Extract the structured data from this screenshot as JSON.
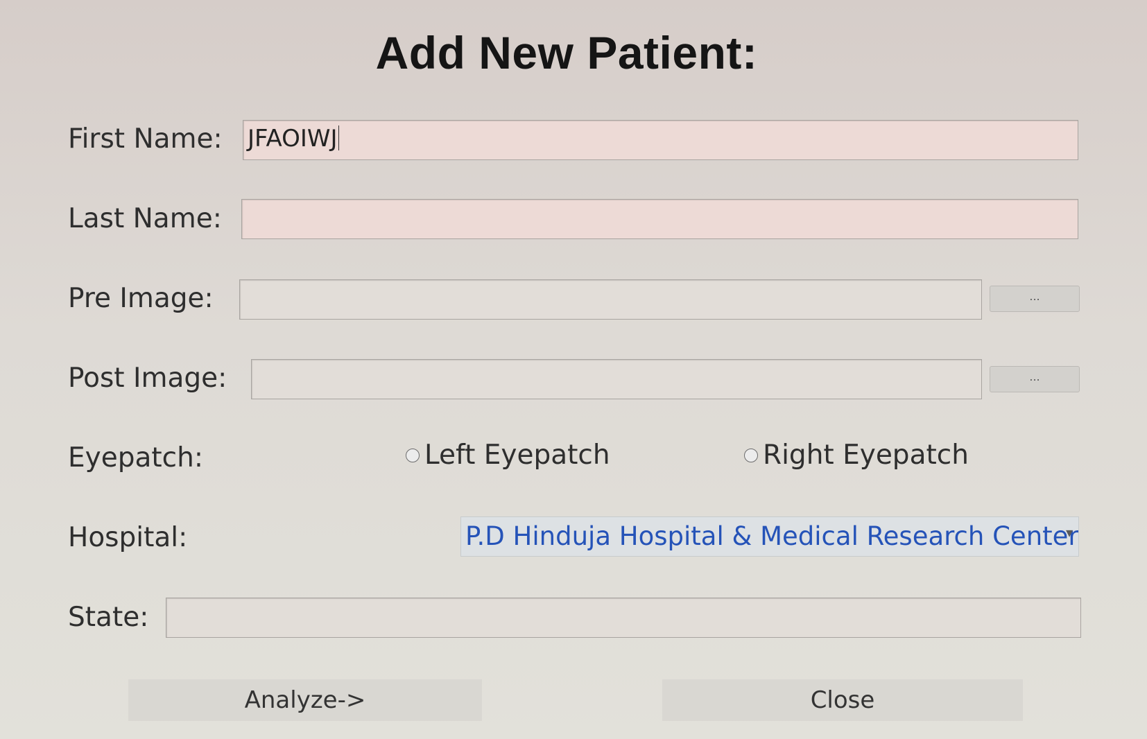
{
  "dialog": {
    "title": "Add New Patient:"
  },
  "form": {
    "first_name": {
      "label": "First Name:",
      "value": "JFAOIWJ"
    },
    "last_name": {
      "label": "Last Name:",
      "value": ""
    },
    "pre_image": {
      "label": "Pre Image:",
      "value": "",
      "browse_label": "..."
    },
    "post_image": {
      "label": "Post Image:",
      "value": "",
      "browse_label": "..."
    },
    "eyepatch": {
      "label": "Eyepatch:",
      "options": [
        "Left Eyepatch",
        "Right Eyepatch"
      ],
      "selected": null
    },
    "hospital": {
      "label": "Hospital:",
      "selected": "P.D Hinduja Hospital & Medical Research Center",
      "chevron": "▾"
    },
    "state": {
      "label": "State:",
      "value": ""
    }
  },
  "buttons": {
    "analyze": "Analyze->",
    "close": "Close"
  },
  "colors": {
    "hospital_text": "#2553b8",
    "input_background": "#eddad6"
  }
}
